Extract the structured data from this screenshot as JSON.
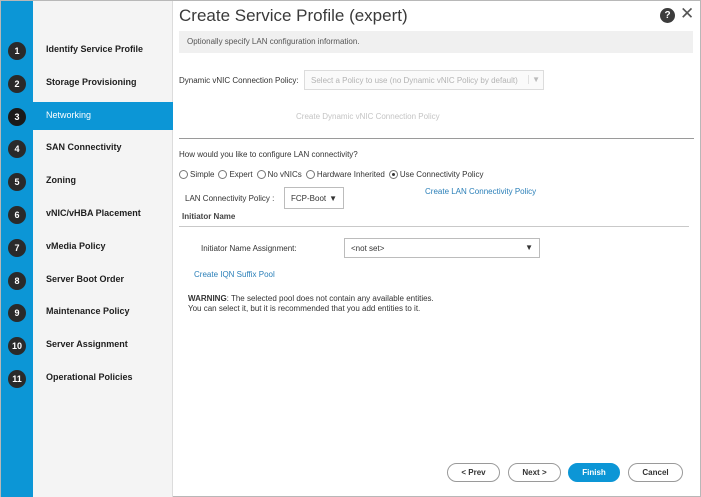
{
  "dialog": {
    "title": "Create Service Profile (expert)",
    "help_glyph": "?",
    "close_glyph": "✕",
    "info": "Optionally specify LAN configuration information."
  },
  "steps": [
    {
      "num": "1",
      "label": "Identify Service Profile"
    },
    {
      "num": "2",
      "label": "Storage Provisioning"
    },
    {
      "num": "3",
      "label": "Networking",
      "active": true
    },
    {
      "num": "4",
      "label": "SAN Connectivity"
    },
    {
      "num": "5",
      "label": "Zoning"
    },
    {
      "num": "6",
      "label": "vNIC/vHBA Placement"
    },
    {
      "num": "7",
      "label": "vMedia Policy"
    },
    {
      "num": "8",
      "label": "Server Boot Order"
    },
    {
      "num": "9",
      "label": "Maintenance Policy"
    },
    {
      "num": "10",
      "label": "Server Assignment"
    },
    {
      "num": "11",
      "label": "Operational Policies"
    }
  ],
  "dynamic_vnic": {
    "label": "Dynamic vNIC Connection Policy:",
    "placeholder": "Select a Policy to use (no Dynamic vNIC Policy by default)",
    "create_link": "Create Dynamic vNIC Connection Policy"
  },
  "lan": {
    "question": "How would you like to configure LAN connectivity?",
    "options": [
      "Simple",
      "Expert",
      "No vNICs",
      "Hardware Inherited",
      "Use Connectivity Policy"
    ],
    "selected_option": "Use Connectivity Policy",
    "policy_label": "LAN Connectivity Policy :",
    "policy_value": "FCP-Boot",
    "create_link": "Create LAN Connectivity Policy"
  },
  "initiator": {
    "section_title": "Initiator Name",
    "assignment_label": "Initiator Name Assignment:",
    "assignment_value": "<not set>",
    "create_link": "Create IQN Suffix Pool"
  },
  "warning": {
    "bold": "WARNING",
    "line1_rest": ": The selected pool does not contain any available entities.",
    "line2": "You can select it, but it is recommended that you add entities to it."
  },
  "buttons": {
    "prev": "< Prev",
    "next": "Next >",
    "finish": "Finish",
    "cancel": "Cancel"
  },
  "colors": {
    "accent": "#0c96d6",
    "link": "#2a7fb8"
  },
  "icons": {
    "dropdown": "▼"
  }
}
